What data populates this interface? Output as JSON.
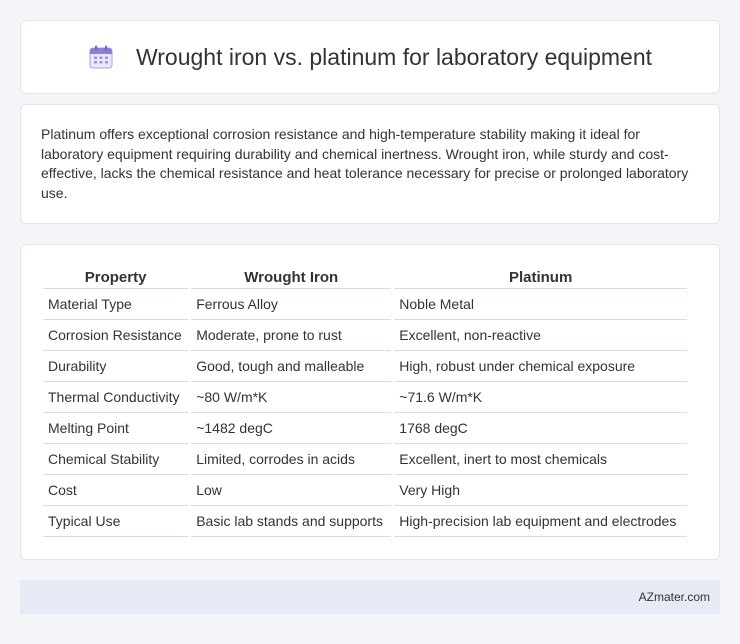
{
  "header": {
    "title": "Wrought iron vs. platinum for laboratory equipment",
    "icon": "calendar-icon",
    "icon_color": "#8b7fd6"
  },
  "summary": {
    "text": "Platinum offers exceptional corrosion resistance and high-temperature stability making it ideal for laboratory equipment requiring durability and chemical inertness. Wrought iron, while sturdy and cost-effective, lacks the chemical resistance and heat tolerance necessary for precise or prolonged laboratory use."
  },
  "table": {
    "headers": [
      "Property",
      "Wrought Iron",
      "Platinum"
    ],
    "rows": [
      [
        "Material Type",
        "Ferrous Alloy",
        "Noble Metal"
      ],
      [
        "Corrosion Resistance",
        "Moderate, prone to rust",
        "Excellent, non-reactive"
      ],
      [
        "Durability",
        "Good, tough and malleable",
        "High, robust under chemical exposure"
      ],
      [
        "Thermal Conductivity",
        "~80 W/m*K",
        "~71.6 W/m*K"
      ],
      [
        "Melting Point",
        "~1482 degC",
        "1768 degC"
      ],
      [
        "Chemical Stability",
        "Limited, corrodes in acids",
        "Excellent, inert to most chemicals"
      ],
      [
        "Cost",
        "Low",
        "Very High"
      ],
      [
        "Typical Use",
        "Basic lab stands and supports",
        "High-precision lab equipment and electrodes"
      ]
    ]
  },
  "footer": {
    "brand": "AZmater.com"
  }
}
